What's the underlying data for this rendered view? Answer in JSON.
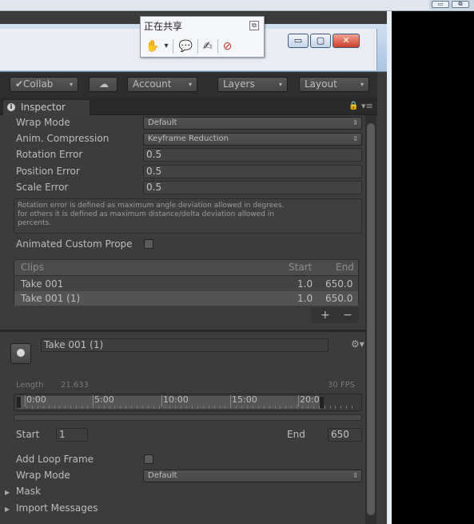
{
  "share_bar": {
    "title": "正在共享",
    "close_glyph": "⧉",
    "tools": [
      "✋",
      "▾",
      "💬",
      "✍",
      "⊘"
    ]
  },
  "window_buttons": {
    "minimize": "▭",
    "maximize": "▢",
    "close": "✕"
  },
  "top_controls": {
    "minimize": "▭",
    "restore": "⧉"
  },
  "toolbar": {
    "collab": "✔Collab",
    "cloud": "☁",
    "account": "Account",
    "layers": "Layers",
    "layout": "Layout",
    "arrow": "▾"
  },
  "tab": {
    "label": "Inspector",
    "info": "i",
    "lock": "🔒",
    "menu": "▾≡"
  },
  "import_settings": {
    "wrap_mode": {
      "label": "Wrap Mode",
      "value": "Default"
    },
    "anim_compression": {
      "label": "Anim. Compression",
      "value": "Keyframe Reduction"
    },
    "rotation_error": {
      "label": "Rotation Error",
      "value": "0.5"
    },
    "position_error": {
      "label": "Position Error",
      "value": "0.5"
    },
    "scale_error": {
      "label": "Scale Error",
      "value": "0.5"
    },
    "help_text": "Rotation error is defined as maximum angle deviation allowed in degrees,\nfor others it is defined as maximum distance/delta deviation allowed in\npercents.",
    "animated_custom_props": {
      "label": "Animated Custom Prope",
      "checked": false
    }
  },
  "clips": {
    "headers": {
      "name": "Clips",
      "start": "Start",
      "end": "End"
    },
    "rows": [
      {
        "name": "Take 001",
        "start": "1.0",
        "end": "650.0",
        "selected": false
      },
      {
        "name": "Take 001 (1)",
        "start": "1.0",
        "end": "650.0",
        "selected": true
      }
    ],
    "add": "+",
    "remove": "−"
  },
  "clip_editor": {
    "name": "Take 001 (1)",
    "gear": "⚙▾",
    "length_label": "Length",
    "length_value": "21.633",
    "fps": "30 FPS",
    "timeline_ticks": [
      "0:00",
      "5:00",
      "10:00",
      "15:00",
      "20:0"
    ],
    "start_label": "Start",
    "start_value": "1",
    "end_label": "End",
    "end_value": "650",
    "add_loop_frame": {
      "label": "Add Loop Frame",
      "checked": false
    },
    "wrap_mode": {
      "label": "Wrap Mode",
      "value": "Default"
    },
    "mask": "Mask",
    "import_messages": "Import Messages",
    "fold_glyph": "▶"
  },
  "dropdown_glyph": "⇕"
}
